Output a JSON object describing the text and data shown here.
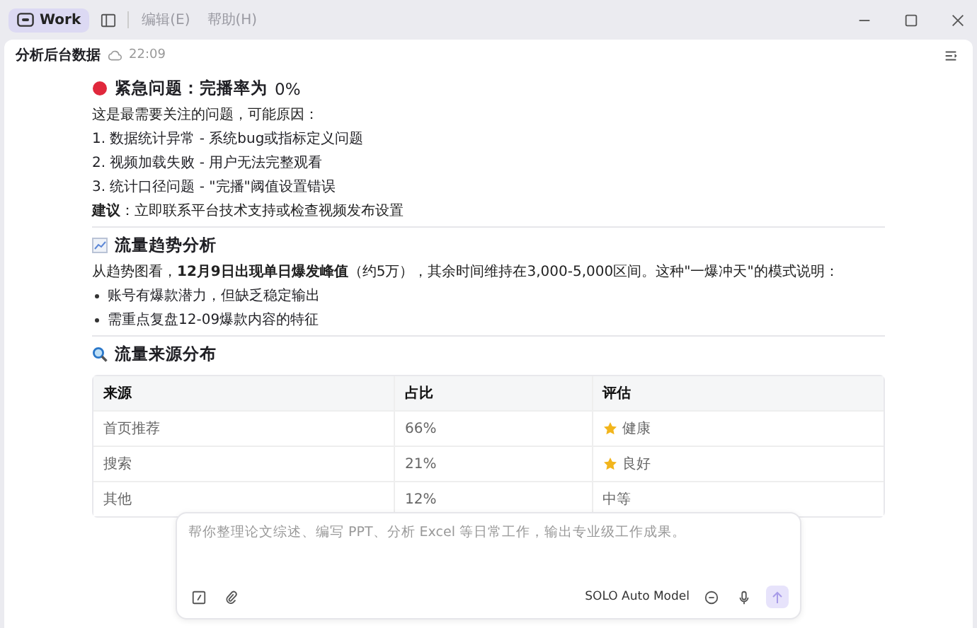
{
  "titlebar": {
    "tab": {
      "label": "Work",
      "selected": true
    },
    "menus": [
      {
        "label": "编辑(E)",
        "disabled": true
      },
      {
        "label": "帮助(H)",
        "disabled": true
      }
    ]
  },
  "header": {
    "title": "分析后台数据",
    "time": "22:09"
  },
  "sections": [
    {
      "kind": "alert",
      "heading_bold": "紧急问题：完播率为",
      "heading_rest": "0%",
      "paragraphs": [
        "这是最需要关注的问题，可能原因："
      ],
      "ordered": [
        "1. 数据统计异常 - 系统bug或指标定义问题",
        "2. 视频加载失败 - 用户无法完整观看",
        "3. 统计口径问题 - \"完播\"阈值设置错误"
      ],
      "note": "**建议**：立即联系平台技术支持或检查视频发布设置"
    },
    {
      "kind": "trend",
      "heading_bold": "流量趋势分析",
      "paragraphs": [
        "从趋势图看，**12月9日出现单日爆发峰值**（约5万），其余时间维持在3,000-5,000区间。这种\"一爆冲天\"的模式说明："
      ],
      "bullets": [
        "账号有爆款潜力，但缺乏稳定输出",
        "需重点复盘12-09爆款内容的特征"
      ]
    },
    {
      "kind": "search",
      "heading_bold": "流量来源分布",
      "table": {
        "columns": [
          "来源",
          "占比",
          "评估"
        ],
        "rows": [
          {
            "source": "首页推荐",
            "share": "66%",
            "rating": "健康",
            "starred": true
          },
          {
            "source": "搜索",
            "share": "21%",
            "rating": "良好",
            "starred": true
          },
          {
            "source": "其他",
            "share": "12%",
            "rating": "中等",
            "starred": false
          }
        ]
      }
    }
  ],
  "composer": {
    "placeholder": "帮你整理论文综述、编写 PPT、分析 Excel 等日常工作，输出专业级工作成果。",
    "model": "SOLO Auto Model",
    "send_disabled": true
  }
}
